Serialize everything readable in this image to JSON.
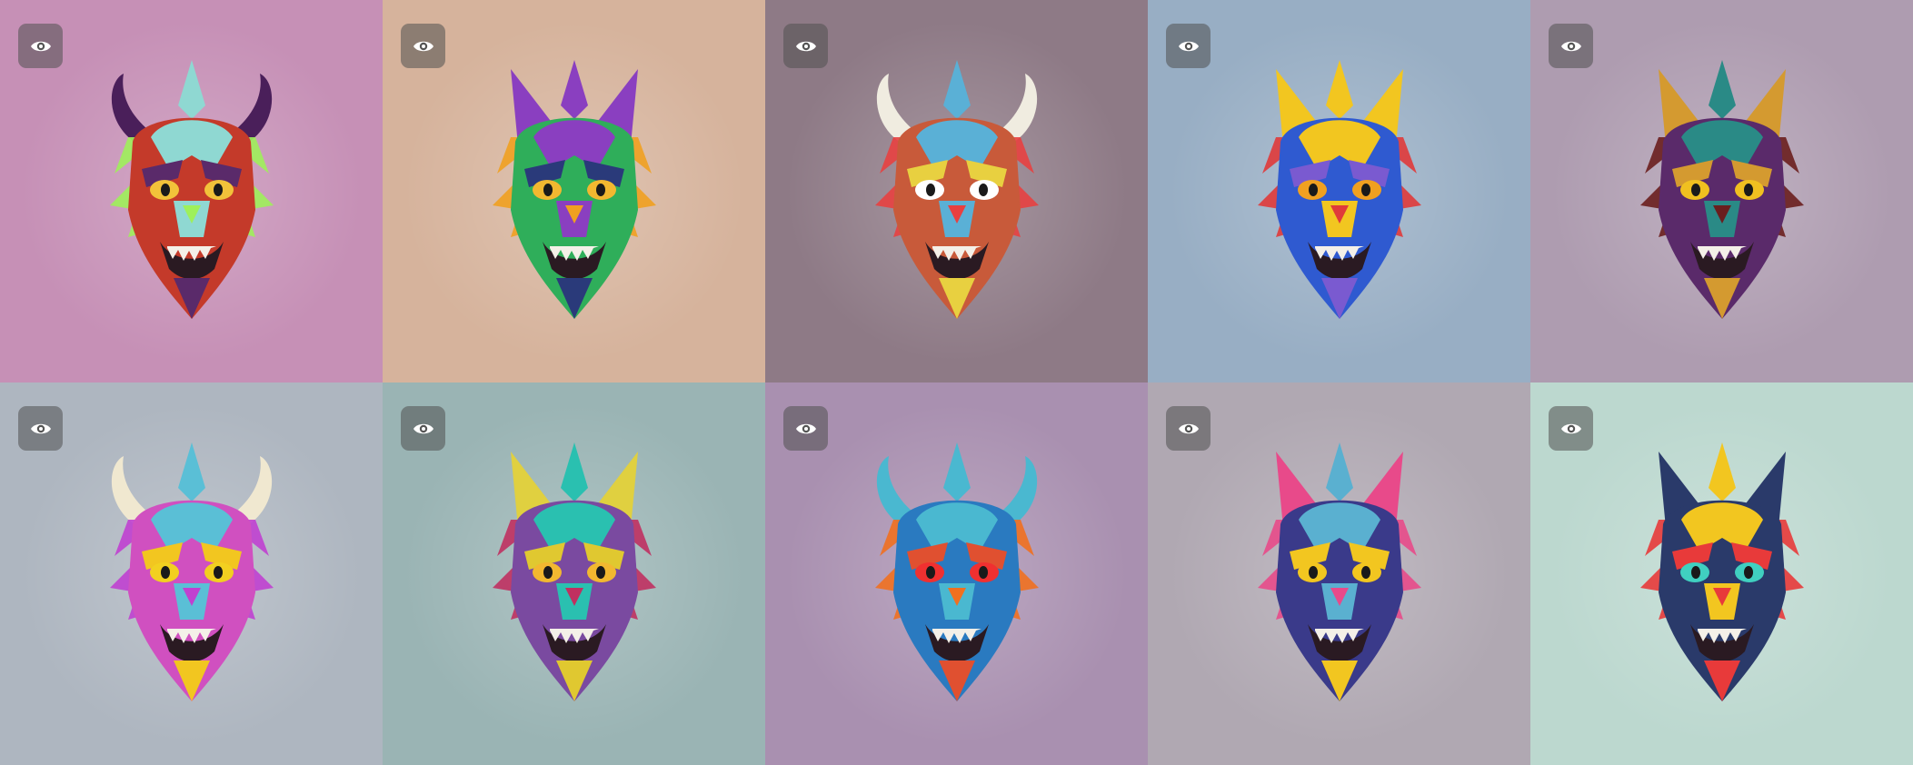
{
  "gallery": {
    "tiles": [
      {
        "bg": "#c690b6",
        "c1": "#c43a2a",
        "c2": "#8fd8d2",
        "c3": "#5a2a6a",
        "horn": "#4a1f5a",
        "eye": "#f2c23a",
        "accent": "#9ef05a",
        "icon": "eye-icon",
        "mask": "horned-demon-mask"
      },
      {
        "bg": "#d6b39c",
        "c1": "#2fae5a",
        "c2": "#8a3fc0",
        "c3": "#2a3a7a",
        "horn": "#8a3fc0",
        "eye": "#f2b830",
        "accent": "#f0a020",
        "icon": "eye-icon",
        "mask": "bird-mask"
      },
      {
        "bg": "#8e7a86",
        "c1": "#c85a3a",
        "c2": "#5ab0d6",
        "c3": "#e8d040",
        "horn": "#f0ece0",
        "eye": "#ffffff",
        "accent": "#e84040",
        "icon": "eye-icon",
        "mask": "cyclops-mask"
      },
      {
        "bg": "#98aec4",
        "c1": "#2f5ad0",
        "c2": "#f2c620",
        "c3": "#7a5ad0",
        "horn": "#f2c620",
        "eye": "#f0a020",
        "accent": "#e03a3a",
        "icon": "eye-icon",
        "mask": "blue-dragon-mask"
      },
      {
        "bg": "#ae9cb0",
        "c1": "#5a2a6a",
        "c2": "#2a8a86",
        "c3": "#d49a30",
        "horn": "#d49a30",
        "eye": "#f0c020",
        "accent": "#6a1e1e",
        "icon": "eye-icon",
        "mask": "dark-dragon-mask"
      },
      {
        "bg": "#aeb6c0",
        "c1": "#d050c0",
        "c2": "#5abfd6",
        "c3": "#f2c620",
        "horn": "#f0e8d0",
        "eye": "#f2d020",
        "accent": "#c040d0",
        "icon": "eye-icon",
        "mask": "owl-mask"
      },
      {
        "bg": "#9ab4b4",
        "c1": "#7a4aa0",
        "c2": "#2ac0b0",
        "c3": "#e0c830",
        "horn": "#e0d040",
        "eye": "#f2b830",
        "accent": "#c03060",
        "icon": "eye-icon",
        "mask": "horned-beast-mask"
      },
      {
        "bg": "#a990b0",
        "c1": "#2a7ac0",
        "c2": "#4ab8d0",
        "c3": "#e05030",
        "horn": "#4ab8d0",
        "eye": "#f03030",
        "accent": "#f07020",
        "icon": "eye-icon",
        "mask": "fanged-dragon-mask"
      },
      {
        "bg": "#b0a8b2",
        "c1": "#3a3a8a",
        "c2": "#5ab0d0",
        "c3": "#f2c620",
        "horn": "#e84a8a",
        "eye": "#f2c620",
        "accent": "#e84a8a",
        "icon": "eye-icon",
        "mask": "tribal-dragon-mask"
      },
      {
        "bg": "#bcd8cf",
        "c1": "#2a3a6a",
        "c2": "#f2c620",
        "c3": "#e83a3a",
        "horn": "#2a3a6a",
        "eye": "#40d0c0",
        "accent": "#e83a3a",
        "icon": "eye-icon",
        "mask": "fox-mask"
      }
    ]
  }
}
